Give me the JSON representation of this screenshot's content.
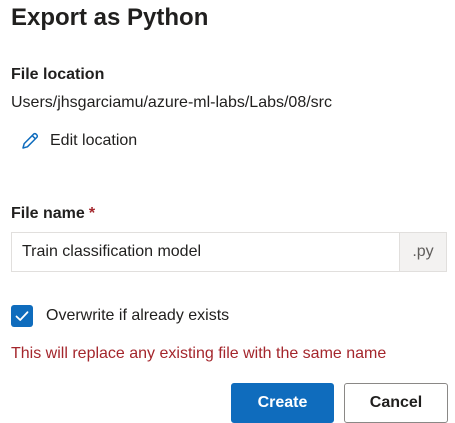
{
  "dialog": {
    "title": "Export as Python"
  },
  "file_location": {
    "label": "File location",
    "path": "Users/jhsgarciamu/azure-ml-labs/Labs/08/src",
    "edit_label": "Edit location",
    "edit_icon": "pencil-icon"
  },
  "file_name": {
    "label": "File name",
    "required_mark": "*",
    "value": "Train classification model",
    "extension": ".py"
  },
  "overwrite": {
    "label": "Overwrite if already exists",
    "checked": true,
    "check_icon": "checkmark-icon"
  },
  "warning": {
    "text": "This will replace any existing file with the same name"
  },
  "actions": {
    "create_label": "Create",
    "cancel_label": "Cancel"
  },
  "colors": {
    "accent": "#0f6cbd",
    "error": "#a4262c",
    "text": "#201f1e"
  }
}
